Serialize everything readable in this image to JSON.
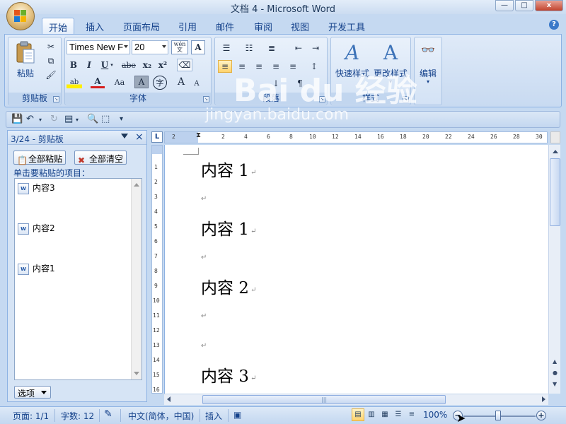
{
  "window": {
    "title": "文档 4 - Microsoft Word",
    "controls": [
      "—",
      "□",
      "x"
    ]
  },
  "tabs": [
    {
      "label": "开始",
      "active": true
    },
    {
      "label": "插入"
    },
    {
      "label": "页面布局"
    },
    {
      "label": "引用"
    },
    {
      "label": "邮件"
    },
    {
      "label": "审阅"
    },
    {
      "label": "视图"
    },
    {
      "label": "开发工具"
    }
  ],
  "ribbon": {
    "clipboard": {
      "paste_label": "粘贴",
      "group_label": "剪贴板"
    },
    "font": {
      "font_name": "Times New F",
      "font_size": "20",
      "wen_label": "wén\n文",
      "bold": "B",
      "italic": "I",
      "underline": "U",
      "strike": "abe",
      "subscript": "x₂",
      "superscript": "x²",
      "highlight": "ab",
      "font_color": "A",
      "change_case": "Aa",
      "shade": "A",
      "enclose": "字",
      "grow": "A",
      "shrink": "A",
      "group_label": "字体"
    },
    "paragraph": {
      "group_label": "段落"
    },
    "styles": {
      "quick_styles": "快速样式",
      "change_styles": "更改样式",
      "group_label": "样式"
    },
    "editing": {
      "label": "编辑"
    }
  },
  "clipboard_pane": {
    "title": "3/24 - 剪贴板",
    "paste_all": "全部粘贴",
    "clear_all": "全部清空",
    "hint": "单击要粘贴的项目：",
    "items": [
      "内容3",
      "内容2",
      "内容1"
    ],
    "item_icon_text": "W",
    "options": "选项"
  },
  "ruler": {
    "corner": "L",
    "h_ticks": [
      "2",
      "2",
      "4",
      "6",
      "8",
      "10",
      "12",
      "14",
      "16",
      "18",
      "20",
      "22",
      "24",
      "26",
      "28",
      "30"
    ],
    "v_ticks": [
      "1",
      "2",
      "3",
      "4",
      "5",
      "6",
      "7",
      "8",
      "9",
      "10",
      "11",
      "12",
      "13",
      "14",
      "15",
      "16"
    ]
  },
  "document": {
    "lines": [
      "内容 1",
      "内容 1",
      "内容 2",
      "内容 3"
    ],
    "para_mark": "↵"
  },
  "statusbar": {
    "page": "页面: 1/1",
    "words": "字数: 12",
    "language": "中文(简体，中国)",
    "insert_mode": "插入",
    "zoom": "100%"
  },
  "watermark": {
    "brand": "Bai du 经验",
    "url": "jingyan.baidu.com"
  },
  "colors": {
    "ribbon_bg": "#dfeaf8",
    "accent": "#15428b",
    "active_button": "#ffd36c"
  }
}
